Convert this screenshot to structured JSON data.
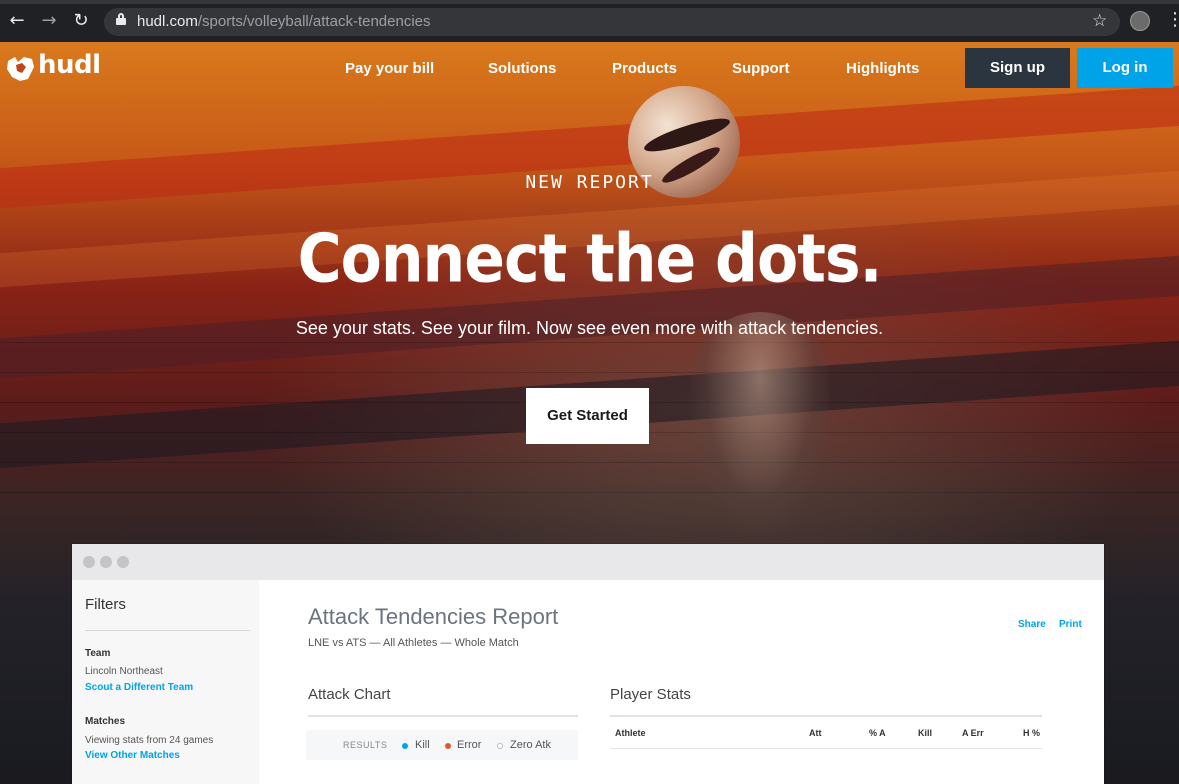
{
  "browser": {
    "url_host": "hudl.com",
    "url_path": "/sports/volleyball/attack-tendencies",
    "icons": [
      "back-icon",
      "forward-icon",
      "reload-icon",
      "lock-icon",
      "star-icon",
      "profile-icon",
      "menu-icon"
    ]
  },
  "nav": {
    "logo_text": "hudl",
    "links": [
      "Pay your bill",
      "Solutions",
      "Products",
      "Support",
      "Highlights"
    ],
    "signup": "Sign up",
    "login": "Log in"
  },
  "hero": {
    "eyebrow": "NEW REPORT",
    "headline": "Connect the dots.",
    "subheadline": "See your stats. See your film. Now see even more with attack tendencies.",
    "cta": "Get Started"
  },
  "report": {
    "filters_title": "Filters",
    "team_label": "Team",
    "team_value": "Lincoln Northeast",
    "team_link": "Scout a Different Team",
    "matches_label": "Matches",
    "matches_value": "Viewing stats from 24 games",
    "matches_link": "View Other Matches",
    "title": "Attack Tendencies Report",
    "subtitle": "LNE vs ATS — All Athletes — Whole Match",
    "share": "Share",
    "print": "Print",
    "attack_chart_title": "Attack Chart",
    "player_stats_title": "Player Stats",
    "legend": {
      "label": "RESULTS",
      "kill": "Kill",
      "error": "Error",
      "zero": "Zero Atk"
    },
    "columns": [
      "Athlete",
      "Att",
      "% A",
      "Kill",
      "A Err",
      "H %"
    ]
  },
  "colors": {
    "brand_blue": "#00a3e8",
    "signup_bg": "#2b3540",
    "kill": "#00a3e8",
    "error": "#e05a2b",
    "zero": "#bbbbbb"
  }
}
